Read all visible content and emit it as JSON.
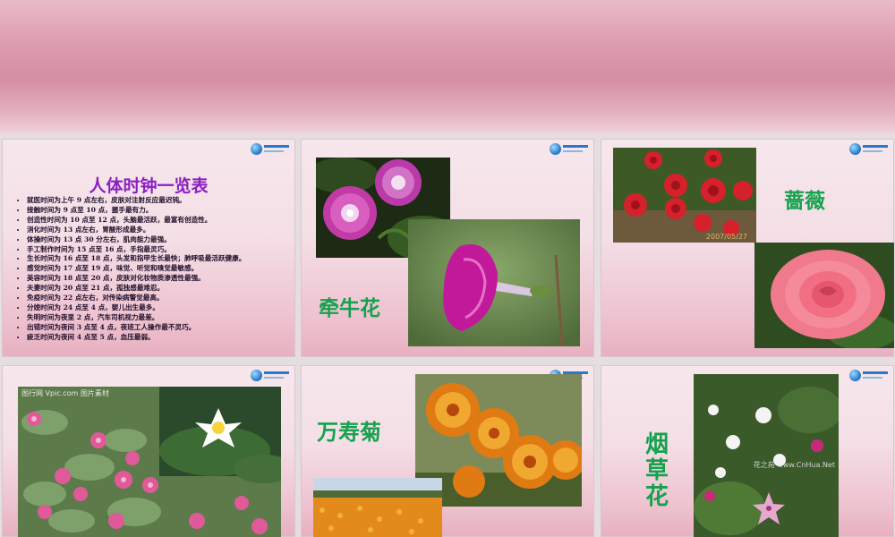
{
  "slides": {
    "clock": {
      "title": "人体时钟一览表",
      "items": [
        "就医时间为上午 9 点左右，皮肤对注射反应最迟钝。",
        "接触时间为 9 点至 10 点，握手最有力。",
        "创造性时间为 10 点至 12 点，头脑最活跃，最富有创造性。",
        "消化时间为 13 点左右，胃酸形成最多。",
        "体操时间为 13 点 30 分左右，肌肉能力最强。",
        "手工制作时间为 15 点至 16 点，手指最灵巧。",
        "生长时间为 16 点至 18 点，头发和指甲生长最快；肺呼吸最活跃健康。",
        "感觉时间为 17 点至 19 点，味觉、听觉和嗅觉最敏感。",
        "美容时间为 18 点至 20 点，皮肤对化妆物质渗透性最强。",
        "夫妻时间为 20 点至 21 点，孤独感最难忍。",
        "免疫时间为 22 点左右，对传染病警觉最高。",
        "分娩时间为 24 点至 4 点，婴儿出生最多。",
        "失明时间为夜里 2 点，汽车司机视力最差。",
        "出错时间为夜间 3 点至 4 点，夜班工人操作最不灵巧。",
        "疲乏时间为夜间 4 点至 5 点，血压最弱。"
      ]
    },
    "morning_glory": {
      "label": "牵牛花"
    },
    "rose": {
      "label": "蔷薇",
      "photo_stamp": "2007/05/27"
    },
    "lotus": {
      "watermark": "图行网 Vpic.com 图片素材"
    },
    "marigold": {
      "label": "万寿菊"
    },
    "tobacco": {
      "label": "烟草花",
      "watermark": "花之苑 www.CnHua.Net"
    }
  },
  "colors": {
    "title_purple": "#8a1fc2",
    "label_green": "#16a14e",
    "banner_pink": "#d58ea3"
  },
  "icons": {
    "logo": "site-logo-icon"
  }
}
